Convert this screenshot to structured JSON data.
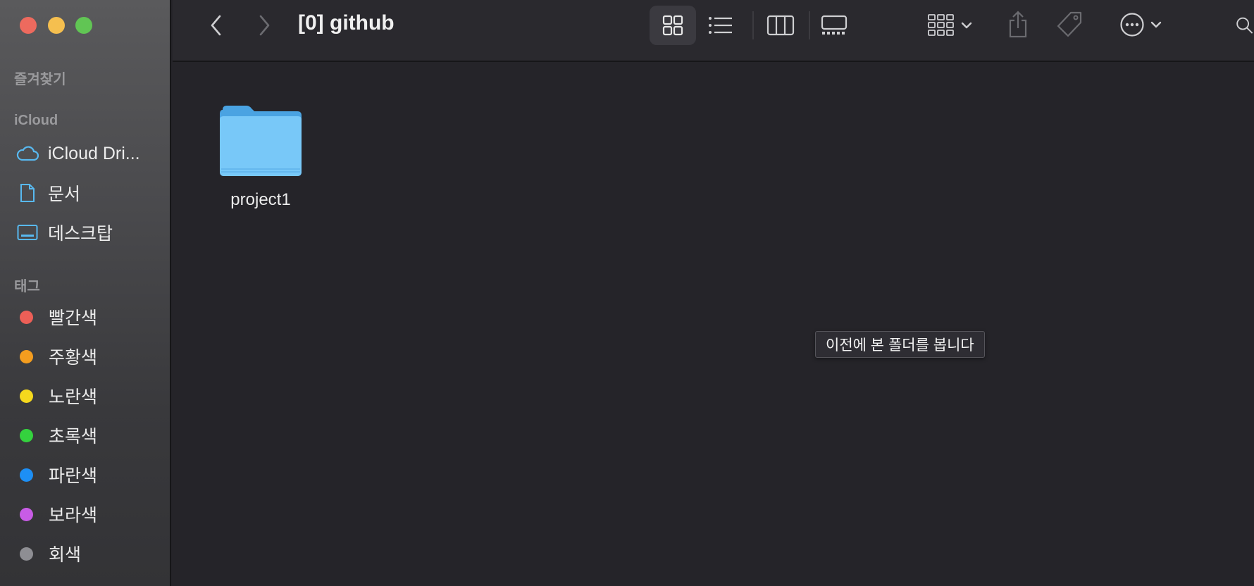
{
  "window": {
    "title": "[0] github"
  },
  "sidebar": {
    "favorites_title": "즐겨찾기",
    "icloud_title": "iCloud",
    "icloud_items": [
      {
        "label": "iCloud Dri...",
        "icon": "cloud-icon"
      },
      {
        "label": "문서",
        "icon": "document-icon"
      },
      {
        "label": "데스크탑",
        "icon": "desktop-icon"
      }
    ],
    "tags_title": "태그",
    "tags": [
      {
        "label": "빨간색",
        "color": "#ec5f57"
      },
      {
        "label": "주황색",
        "color": "#f49d1f"
      },
      {
        "label": "노란색",
        "color": "#f5d91d"
      },
      {
        "label": "초록색",
        "color": "#34d23e"
      },
      {
        "label": "파란색",
        "color": "#1d8ff5"
      },
      {
        "label": "보라색",
        "color": "#c85ce6"
      },
      {
        "label": "회색",
        "color": "#8e8e93"
      }
    ]
  },
  "toolbar": {
    "back": "chevron-left-icon",
    "forward": "chevron-right-icon",
    "views": [
      "icon-view",
      "list-view",
      "column-view",
      "gallery-view"
    ],
    "selected_view": "icon-view"
  },
  "content": {
    "items": [
      {
        "name": "project1",
        "type": "folder"
      }
    ]
  },
  "tooltip": {
    "text": "이전에 본 폴더를 봅니다"
  },
  "colors": {
    "folder": "#6cbff2",
    "cloud_icon": "#58b9f0",
    "background": "#252429"
  }
}
